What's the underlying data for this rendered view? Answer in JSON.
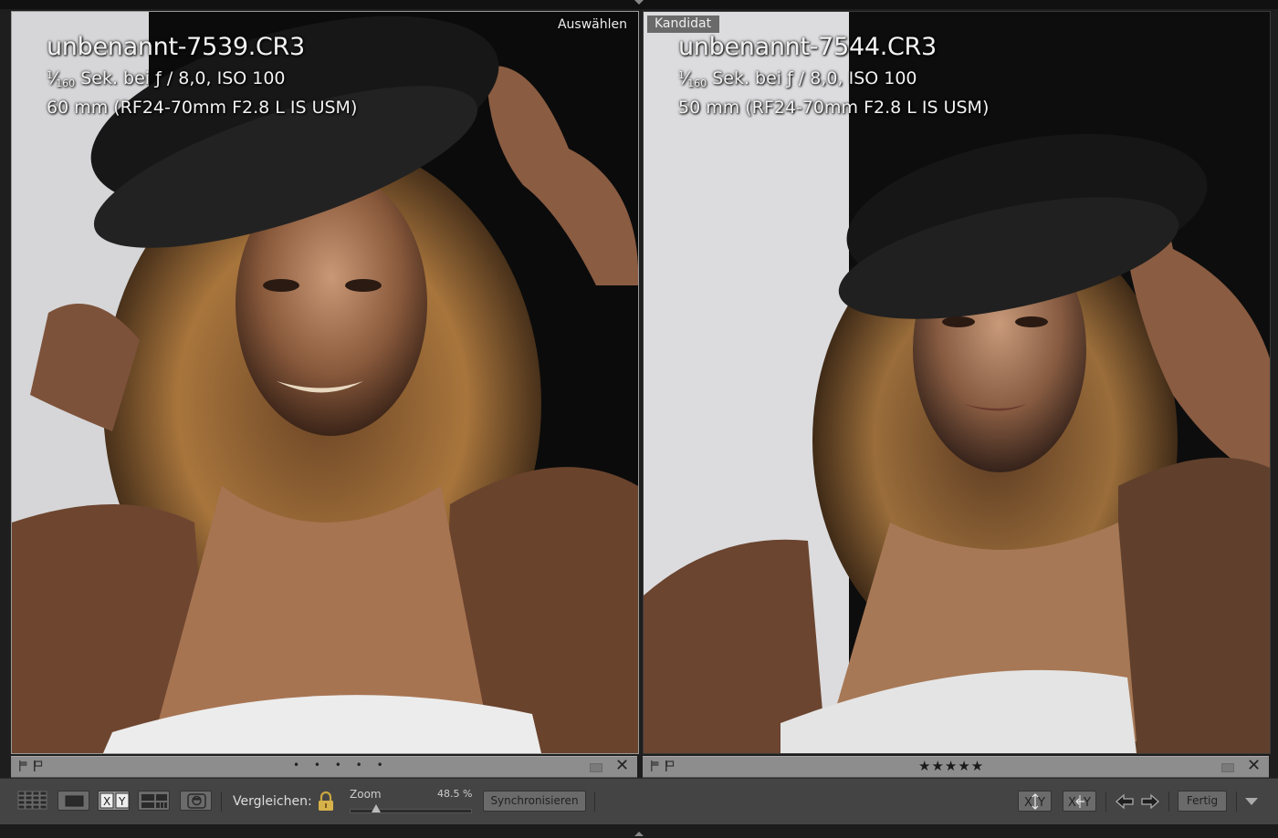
{
  "left_pane": {
    "label": "Auswählen",
    "filename": "unbenannt-7539.CR3",
    "shutter_num": "1",
    "shutter_den": "160",
    "exposure_rest": " Sek. bei ƒ / 8,0, ISO 100",
    "lens": "60 mm (RF24-70mm F2.8 L IS USM)",
    "rating_dots": "• • • • •"
  },
  "right_pane": {
    "label": "Kandidat",
    "filename": "unbenannt-7544.CR3",
    "shutter_num": "1",
    "shutter_den": "160",
    "exposure_rest": " Sek. bei ƒ / 8,0, ISO 100",
    "lens": "50 mm (RF24-70mm F2.8 L IS USM)",
    "rating_stars": "★★★★★",
    "rating": 5
  },
  "toolbar": {
    "compare_label": "Vergleichen:",
    "zoom_label": "Zoom",
    "zoom_value": "48.5 %",
    "zoom_fraction": 0.22,
    "sync_label": "Synchronisieren",
    "done_label": "Fertig"
  },
  "icons": {
    "grid": "grid-view-icon",
    "loupe": "loupe-view-icon",
    "compare": "compare-view-icon",
    "survey": "survey-view-icon",
    "people": "people-view-icon",
    "lock": "lock-icon",
    "swap": "swap-icon",
    "make_select": "make-select-icon",
    "prev": "arrow-left-icon",
    "next": "arrow-right-icon",
    "menu": "toolbar-menu-icon"
  },
  "colors": {
    "selected_border": "#9a9a9a",
    "toolbar_bg": "#444444",
    "infobar_bg": "#8d8d8d"
  }
}
